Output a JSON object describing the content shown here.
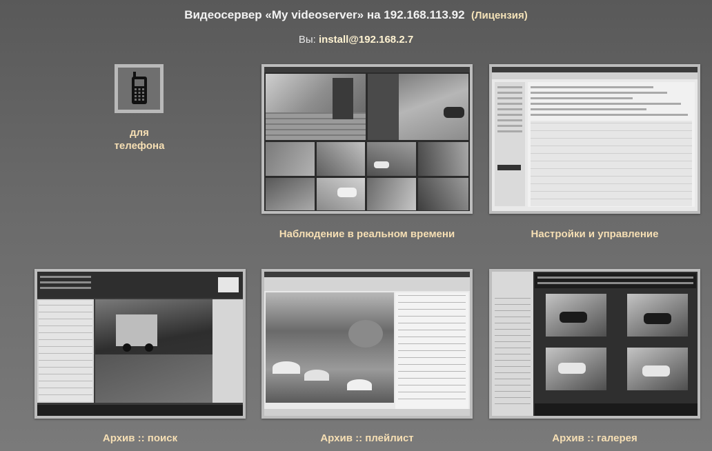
{
  "header": {
    "title": "Видеосервер «My videoserver» на 192.168.113.92",
    "license": "(Лицензия)",
    "user_prefix": "Вы:",
    "user": "install@192.168.2.7"
  },
  "tiles": {
    "phone": {
      "label_line1": "для",
      "label_line2": "телефона",
      "icon": "mobile-phone-icon"
    },
    "live": {
      "label": "Наблюдение в реальном времени"
    },
    "settings": {
      "label": "Настройки и управление"
    },
    "archive_search": {
      "label": "Архив :: поиск"
    },
    "archive_playlist": {
      "label": "Архив :: плейлист"
    },
    "archive_gallery": {
      "label": "Архив :: галерея"
    }
  },
  "colors": {
    "label": "#f6dfb4",
    "title": "#f2f2f2",
    "background_top": "#595959",
    "background_bottom": "#7a7a7a"
  }
}
